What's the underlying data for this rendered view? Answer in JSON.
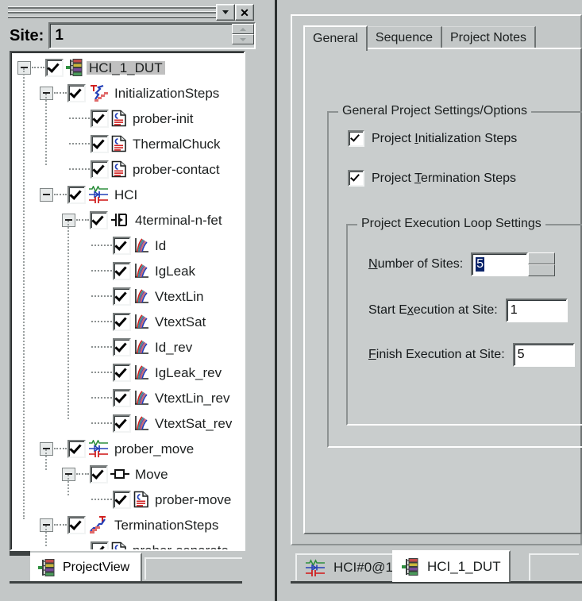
{
  "window": {
    "caption_dropdown_icon": "chevron-down-icon",
    "caption_close_label": "✕"
  },
  "site_selector": {
    "label": "Site:",
    "value": "1"
  },
  "project_tree": {
    "nodes": [
      {
        "label": "HCI_1_DUT",
        "level": 0,
        "icon": "dut-icon",
        "expander": "minus",
        "checked": true,
        "selected": true
      },
      {
        "label": "InitializationSteps",
        "level": 1,
        "icon": "init-steps-icon",
        "expander": "minus",
        "checked": true,
        "selected": false
      },
      {
        "label": "prober-init",
        "level": 2,
        "icon": "document-icon",
        "expander": "none",
        "checked": true,
        "selected": false
      },
      {
        "label": "ThermalChuck",
        "level": 2,
        "icon": "document-icon",
        "expander": "none",
        "checked": true,
        "selected": false
      },
      {
        "label": "prober-contact",
        "level": 2,
        "icon": "document-icon",
        "expander": "none",
        "checked": true,
        "selected": false
      },
      {
        "label": "HCI",
        "level": 1,
        "icon": "device-icon",
        "expander": "minus",
        "checked": true,
        "selected": false
      },
      {
        "label": "4terminal-n-fet",
        "level": 2,
        "icon": "fet-icon",
        "expander": "minus",
        "checked": true,
        "selected": false
      },
      {
        "label": "Id",
        "level": 3,
        "icon": "graph-icon",
        "expander": "none",
        "checked": true,
        "selected": false
      },
      {
        "label": "IgLeak",
        "level": 3,
        "icon": "graph-icon",
        "expander": "none",
        "checked": true,
        "selected": false
      },
      {
        "label": "VtextLin",
        "level": 3,
        "icon": "graph-icon",
        "expander": "none",
        "checked": true,
        "selected": false
      },
      {
        "label": "VtextSat",
        "level": 3,
        "icon": "graph-icon",
        "expander": "none",
        "checked": true,
        "selected": false
      },
      {
        "label": "Id_rev",
        "level": 3,
        "icon": "graph-icon",
        "expander": "none",
        "checked": true,
        "selected": false
      },
      {
        "label": "IgLeak_rev",
        "level": 3,
        "icon": "graph-icon",
        "expander": "none",
        "checked": true,
        "selected": false
      },
      {
        "label": "VtextLin_rev",
        "level": 3,
        "icon": "graph-icon",
        "expander": "none",
        "checked": true,
        "selected": false
      },
      {
        "label": "VtextSat_rev",
        "level": 3,
        "icon": "graph-icon",
        "expander": "none",
        "checked": true,
        "selected": false
      },
      {
        "label": "prober_move",
        "level": 1,
        "icon": "device-icon",
        "expander": "minus",
        "checked": true,
        "selected": false
      },
      {
        "label": "Move",
        "level": 2,
        "icon": "move-icon",
        "expander": "minus",
        "checked": true,
        "selected": false
      },
      {
        "label": "prober-move",
        "level": 3,
        "icon": "document-icon",
        "expander": "none",
        "checked": true,
        "selected": false
      },
      {
        "label": "TerminationSteps",
        "level": 1,
        "icon": "term-steps-icon",
        "expander": "minus",
        "checked": true,
        "selected": false
      },
      {
        "label": "prober-separate",
        "level": 2,
        "icon": "document-icon",
        "expander": "none",
        "checked": true,
        "selected": false
      }
    ]
  },
  "left_tabstrip": {
    "tabs": [
      {
        "label": "ProjectView",
        "icon": "project-tree-icon",
        "active": true
      }
    ]
  },
  "right_panel": {
    "tabs": [
      {
        "label": "General",
        "active": true
      },
      {
        "label": "Sequence",
        "active": false
      },
      {
        "label": "Project Notes",
        "active": false
      }
    ],
    "general_group": {
      "title": "General Project Settings/Options",
      "checkboxes": [
        {
          "pre": "Project ",
          "mnemonic": "I",
          "post": "nitialization Steps",
          "checked": true
        },
        {
          "pre": "Project ",
          "mnemonic": "T",
          "post": "ermination Steps",
          "checked": true
        }
      ],
      "loop_group": {
        "title": "Project Execution Loop Settings",
        "fields": [
          {
            "pre": "",
            "mnemonic": "N",
            "post": "umber of Sites:",
            "value": "5",
            "kind": "spinner",
            "selected": true
          },
          {
            "pre": "Start E",
            "mnemonic": "x",
            "post": "ecution at Site:",
            "value": "1",
            "kind": "text",
            "selected": false
          },
          {
            "pre": "",
            "mnemonic": "F",
            "post": "inish Execution at Site:",
            "value": "5",
            "kind": "text",
            "selected": false
          }
        ]
      }
    }
  },
  "right_tabstrip": {
    "tabs": [
      {
        "label": "HCI#0@1",
        "icon": "device-icon",
        "active": false
      },
      {
        "label": "HCI_1_DUT",
        "icon": "dut-icon",
        "active": true
      }
    ]
  },
  "colors": {
    "face": "#c3c7c7",
    "page": "#c9cdcd",
    "selection": "#0a246a",
    "tree_select": "#c0c0c0",
    "icon_green": "#2f8f3f",
    "icon_red": "#d02020",
    "icon_blue": "#2440b8"
  }
}
